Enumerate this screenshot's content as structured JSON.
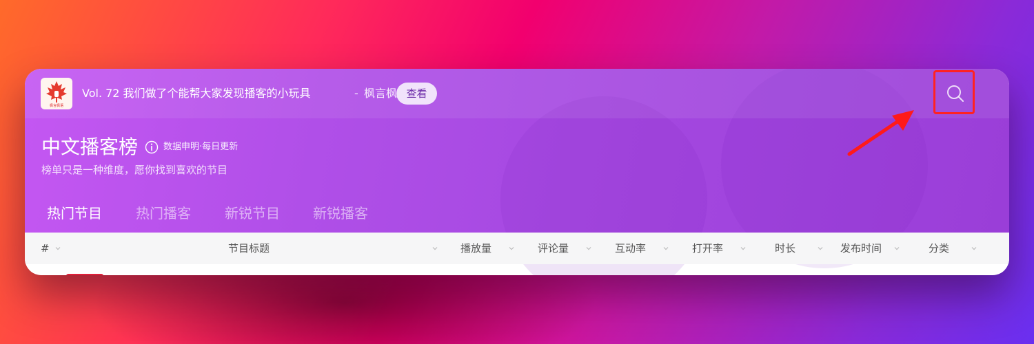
{
  "announcement": {
    "logo_text": "枫言枫语",
    "text": "Vol. 72 我们做了个能帮大家发现播客的小玩具",
    "separator": "-",
    "source": "枫言枫语",
    "button_label": "查看"
  },
  "header": {
    "title": "中文播客榜",
    "data_note": "数据申明·每日更新",
    "subtitle": "榜单只是一种维度，愿你找到喜欢的节目"
  },
  "tabs": [
    {
      "label": "热门节目",
      "active": true
    },
    {
      "label": "热门播客",
      "active": false
    },
    {
      "label": "新锐节目",
      "active": false
    },
    {
      "label": "新锐播客",
      "active": false
    }
  ],
  "columns": [
    {
      "label": "#"
    },
    {
      "label": "节目标题"
    },
    {
      "label": "播放量"
    },
    {
      "label": "评论量"
    },
    {
      "label": "互动率"
    },
    {
      "label": "打开率"
    },
    {
      "label": "时长"
    },
    {
      "label": "发布时间"
    },
    {
      "label": "分类"
    }
  ],
  "icons": {
    "search": "search-icon",
    "info": "info-icon",
    "logo": "maple-leaf-logo",
    "sort": "chevron-down-icon"
  },
  "colors": {
    "highlight_box": "#ff2222",
    "accent_purple": "#b04fe8",
    "row_marker": "#e0203a"
  }
}
